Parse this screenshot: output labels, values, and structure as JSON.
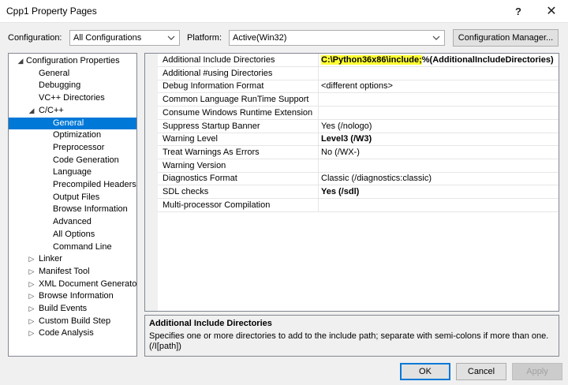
{
  "window": {
    "title": "Cpp1 Property Pages",
    "help_glyph": "?",
    "close_glyph": "✕"
  },
  "config": {
    "configuration_label": "Configuration:",
    "configuration_value": "All Configurations",
    "platform_label": "Platform:",
    "platform_value": "Active(Win32)",
    "manager_button": "Configuration Manager..."
  },
  "tree": [
    {
      "label": "Configuration Properties",
      "level": 0,
      "expander": "collapse"
    },
    {
      "label": "General",
      "level": 1
    },
    {
      "label": "Debugging",
      "level": 1
    },
    {
      "label": "VC++ Directories",
      "level": 1
    },
    {
      "label": "C/C++",
      "level": 1,
      "expander": "collapse"
    },
    {
      "label": "General",
      "level": 2,
      "selected": true
    },
    {
      "label": "Optimization",
      "level": 2
    },
    {
      "label": "Preprocessor",
      "level": 2
    },
    {
      "label": "Code Generation",
      "level": 2
    },
    {
      "label": "Language",
      "level": 2
    },
    {
      "label": "Precompiled Headers",
      "level": 2
    },
    {
      "label": "Output Files",
      "level": 2
    },
    {
      "label": "Browse Information",
      "level": 2
    },
    {
      "label": "Advanced",
      "level": 2
    },
    {
      "label": "All Options",
      "level": 2
    },
    {
      "label": "Command Line",
      "level": 2
    },
    {
      "label": "Linker",
      "level": 1,
      "expander": "expand"
    },
    {
      "label": "Manifest Tool",
      "level": 1,
      "expander": "expand"
    },
    {
      "label": "XML Document Generator",
      "level": 1,
      "expander": "expand"
    },
    {
      "label": "Browse Information",
      "level": 1,
      "expander": "expand"
    },
    {
      "label": "Build Events",
      "level": 1,
      "expander": "expand"
    },
    {
      "label": "Custom Build Step",
      "level": 1,
      "expander": "expand"
    },
    {
      "label": "Code Analysis",
      "level": 1,
      "expander": "expand"
    }
  ],
  "properties": [
    {
      "name": "Additional Include Directories",
      "value_highlight": "C:\\Python36x86\\include;",
      "value": "%(AdditionalIncludeDirectories)",
      "bold": true
    },
    {
      "name": "Additional #using Directories",
      "value": ""
    },
    {
      "name": "Debug Information Format",
      "value": "<different options>"
    },
    {
      "name": "Common Language RunTime Support",
      "value": ""
    },
    {
      "name": "Consume Windows Runtime Extension",
      "value": ""
    },
    {
      "name": "Suppress Startup Banner",
      "value": "Yes (/nologo)"
    },
    {
      "name": "Warning Level",
      "value": "Level3 (/W3)",
      "bold": true
    },
    {
      "name": "Treat Warnings As Errors",
      "value": "No (/WX-)"
    },
    {
      "name": "Warning Version",
      "value": ""
    },
    {
      "name": "Diagnostics Format",
      "value": "Classic (/diagnostics:classic)"
    },
    {
      "name": "SDL checks",
      "value": "Yes (/sdl)",
      "bold": true
    },
    {
      "name": "Multi-processor Compilation",
      "value": ""
    }
  ],
  "description": {
    "title": "Additional Include Directories",
    "text": "Specifies one or more directories to add to the include path; separate with semi-colons if more than one. (/I[path])"
  },
  "buttons": {
    "ok": "OK",
    "cancel": "Cancel",
    "apply": "Apply"
  },
  "colors": {
    "selection": "#0078d7",
    "highlight": "#ffff33",
    "disabled_text": "#a0a0a0"
  }
}
